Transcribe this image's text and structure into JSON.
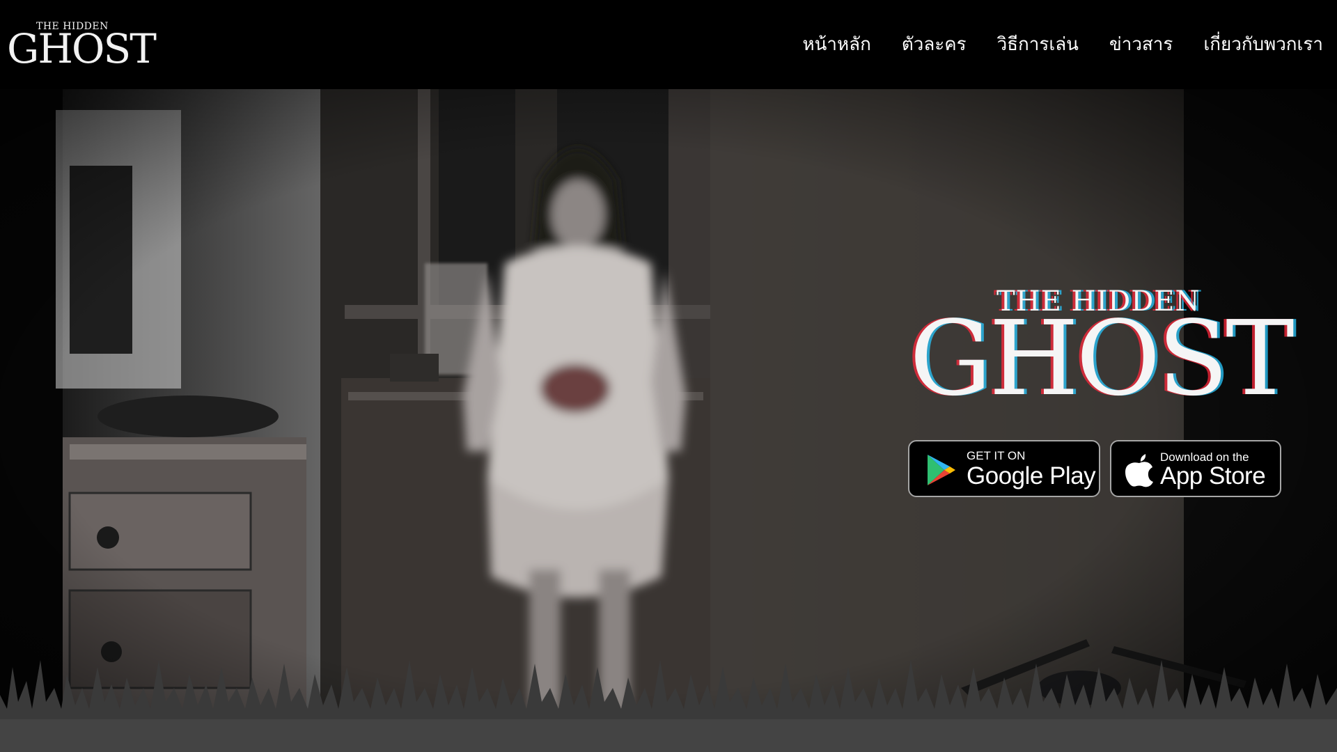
{
  "brand": {
    "small_line1": "THE HIDDEN",
    "small_line2": "GHOST",
    "big_line1": "THE HIDDEN",
    "big_line2": "GHOST"
  },
  "nav": {
    "items": [
      {
        "label": "หน้าหลัก"
      },
      {
        "label": "ตัวละคร"
      },
      {
        "label": "วิธีการเล่น"
      },
      {
        "label": "ข่าวสาร"
      },
      {
        "label": "เกี่ยวกับพวกเรา"
      }
    ]
  },
  "stores": {
    "google": {
      "top": "GET IT ON",
      "main": "Google Play",
      "icon": "google-play-icon"
    },
    "apple": {
      "top": "Download on the",
      "main": "App Store",
      "icon": "apple-icon"
    }
  },
  "colors": {
    "background": "#000000",
    "text": "#ffffff",
    "glitch_red": "#ff283c",
    "glitch_cyan": "#28c8ff",
    "badge_border": "#a6a6a6"
  }
}
